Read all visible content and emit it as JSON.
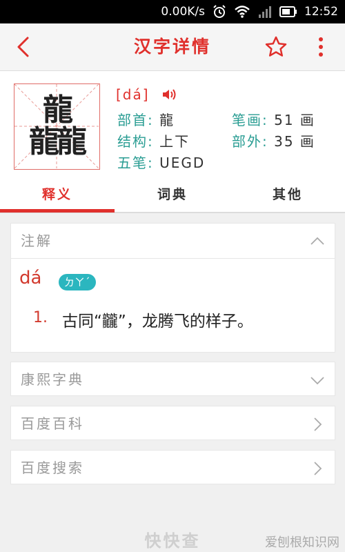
{
  "statusbar": {
    "net_speed": "0.00K/s",
    "time": "12:52"
  },
  "header": {
    "title": "汉字详情"
  },
  "character": {
    "glyph_top": "龍",
    "glyph_bottom": "龍龍",
    "pinyin": "[dá]",
    "radical_label": "部首:",
    "radical_value": "龍",
    "strokes_label": "笔画:",
    "strokes_value": "51 画",
    "structure_label": "结构:",
    "structure_value": "上下",
    "extra_strokes_label": "部外:",
    "extra_strokes_value": "35 画",
    "wubi_label": "五笔:",
    "wubi_value": "UEGD"
  },
  "tabs": [
    {
      "label": "释义",
      "active": true
    },
    {
      "label": "词典",
      "active": false
    },
    {
      "label": "其他",
      "active": false
    }
  ],
  "sections": {
    "notes_title": "注解",
    "notes_pinyin": "dá",
    "notes_zhuyin": "ㄉㄚˊ",
    "definitions": [
      {
        "num": "1.",
        "text": "古同“龖”，龙腾飞的样子。"
      }
    ],
    "kangxi_title": "康熙字典",
    "baike_title": "百度百科",
    "search_title": "百度搜索"
  },
  "footer": {
    "watermark": "快快查",
    "corner_text": "爱刨根知识网"
  },
  "colors": {
    "accent_red": "#e0302c",
    "label_teal": "#2a9d93",
    "badge_teal": "#2bb6bf"
  }
}
